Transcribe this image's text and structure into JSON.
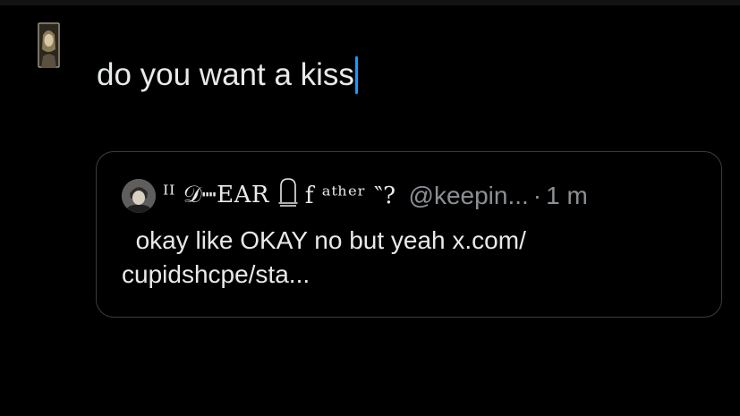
{
  "composer": {
    "text": "do you want a kiss"
  },
  "quote": {
    "display_name_part1": "ᴵᴵ 𝒟┉EAR",
    "display_name_part2": "f ᵃᵗʰᵉʳ ‶? ",
    "handle": "@keepin...",
    "separator": "·",
    "time": "1 m",
    "body": "  okay like OKAY no but yeah x.com/\ncupidshcpe/sta..."
  },
  "colors": {
    "background": "#000000",
    "text": "#e7e9ea",
    "muted": "#8b9095",
    "caret": "#1d9bf0",
    "card_border": "#3a3d41"
  },
  "icons": {
    "composer_avatar": "user-avatar-photo",
    "quote_avatar": "quoted-user-avatar-photo",
    "tombstone": "tombstone-icon"
  }
}
